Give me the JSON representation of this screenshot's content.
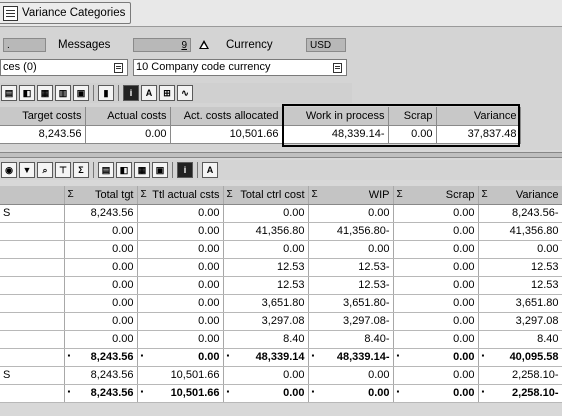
{
  "toolbar": {
    "variance_categories_label": "Variance Categories"
  },
  "selection": {
    "field1_value": ".",
    "messages_label": "Messages",
    "messages_value": "9",
    "currency_label": "Currency",
    "currency_value": "USD",
    "left_dropdown_value": "ces (0)",
    "currency_type_value": "10 Company code currency"
  },
  "summary": {
    "headers": [
      "Target costs",
      "Actual costs",
      "Act. costs allocated",
      "Work in process",
      "Scrap",
      "Variance"
    ],
    "values": [
      "8,243.56",
      "0.00",
      "10,501.66",
      "48,339.14-",
      "0.00",
      "37,837.48"
    ]
  },
  "grid": {
    "headers": [
      "Σ",
      "Total tgt",
      "Σ",
      "Ttl actual csts",
      "Σ",
      "Total ctrl cost",
      "Σ",
      "WIP",
      "Σ",
      "Scrap",
      "Σ",
      "Variance"
    ],
    "rows": [
      {
        "first": "S",
        "tgt": "8,243.56",
        "act": "0.00",
        "ctrl": "0.00",
        "wip": "0.00",
        "scrap": "0.00",
        "var": "8,243.56-"
      },
      {
        "first": "",
        "tgt": "0.00",
        "act": "0.00",
        "ctrl": "41,356.80",
        "wip": "41,356.80-",
        "scrap": "0.00",
        "var": "41,356.80"
      },
      {
        "first": "",
        "tgt": "0.00",
        "act": "0.00",
        "ctrl": "0.00",
        "wip": "0.00",
        "scrap": "0.00",
        "var": "0.00"
      },
      {
        "first": "",
        "tgt": "0.00",
        "act": "0.00",
        "ctrl": "12.53",
        "wip": "12.53-",
        "scrap": "0.00",
        "var": "12.53"
      },
      {
        "first": "",
        "tgt": "0.00",
        "act": "0.00",
        "ctrl": "12.53",
        "wip": "12.53-",
        "scrap": "0.00",
        "var": "12.53"
      },
      {
        "first": "",
        "tgt": "0.00",
        "act": "0.00",
        "ctrl": "3,651.80",
        "wip": "3,651.80-",
        "scrap": "0.00",
        "var": "3,651.80"
      },
      {
        "first": "",
        "tgt": "0.00",
        "act": "0.00",
        "ctrl": "3,297.08",
        "wip": "3,297.08-",
        "scrap": "0.00",
        "var": "3,297.08"
      },
      {
        "first": "",
        "tgt": "0.00",
        "act": "0.00",
        "ctrl": "8.40",
        "wip": "8.40-",
        "scrap": "0.00",
        "var": "8.40"
      }
    ],
    "total1": {
      "tgt": "8,243.56",
      "act": "0.00",
      "ctrl": "48,339.14",
      "wip": "48,339.14-",
      "scrap": "0.00",
      "var": "40,095.58"
    },
    "row_s2": {
      "first": "S",
      "tgt": "8,243.56",
      "act": "10,501.66",
      "ctrl": "0.00",
      "wip": "0.00",
      "scrap": "0.00",
      "var": "2,258.10-"
    },
    "total2": {
      "tgt": "8,243.56",
      "act": "10,501.66",
      "ctrl": "0.00",
      "wip": "0.00",
      "scrap": "0.00",
      "var": "2,258.10-"
    }
  },
  "icons": [
    "list-icon",
    "print-icon",
    "layout-icon",
    "info-icon",
    "filter-icon",
    "sort-icon",
    "sum-icon",
    "find-icon",
    "chart-icon"
  ]
}
